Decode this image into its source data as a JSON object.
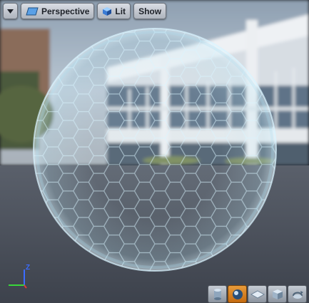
{
  "toolbar": {
    "viewport_menu_icon": "chevron-down-icon",
    "view_type_label": "Perspective",
    "view_type_icon": "perspective-plane-icon",
    "view_mode_label": "Lit",
    "view_mode_icon": "lit-cube-icon",
    "show_label": "Show"
  },
  "axis_indicator": {
    "z_label": "Z",
    "z_color": "#3b6cff",
    "y_color": "#39d63a",
    "x_color": "#e03a3a"
  },
  "preview_modes": {
    "items": [
      {
        "name": "cylinder-icon",
        "active": false
      },
      {
        "name": "sphere-icon",
        "active": true
      },
      {
        "name": "plane-icon",
        "active": false
      },
      {
        "name": "cube-icon",
        "active": false
      },
      {
        "name": "custom-mesh-icon",
        "active": false
      }
    ],
    "active_color": "#e08a24"
  },
  "scene": {
    "sky_color": "#9fb2c6",
    "floor_color": "#4d535f",
    "bubble_color": "#bfe6f4"
  }
}
